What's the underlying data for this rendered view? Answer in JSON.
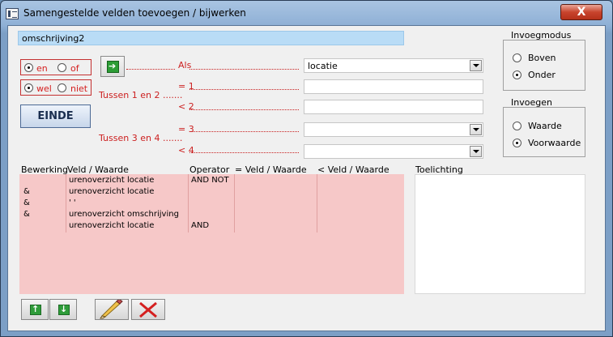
{
  "window": {
    "title": "Samengestelde velden toevoegen / bijwerken",
    "close_label": "X"
  },
  "description_field": {
    "value": "omschrijving2"
  },
  "logic1": {
    "options": [
      "en",
      "of"
    ],
    "selected": "en"
  },
  "logic2": {
    "options": [
      "wel",
      "niet"
    ],
    "selected": "wel"
  },
  "einde_label": "EINDE",
  "criteria": {
    "als_label": "Als",
    "eq1_label": "= 1",
    "lt2_label": "< 2",
    "eq3_label": "= 3",
    "lt4_label": "< 4",
    "between12_label": "Tussen 1 en 2 .......",
    "between34_label": "Tussen 3 en 4 .......",
    "als_value": "locatie",
    "eq1_value": "",
    "lt2_value": "",
    "eq3_value": "",
    "lt4_value": ""
  },
  "invoegmodus": {
    "title": "Invoegmodus",
    "options": [
      "Boven",
      "Onder"
    ],
    "selected": "Onder"
  },
  "invoegen": {
    "title": "Invoegen",
    "options": [
      "Waarde",
      "Voorwaarde"
    ],
    "selected": "Voorwaarde"
  },
  "table": {
    "headers": [
      "Bewerking",
      "Veld / Waarde",
      "Operator",
      "= Veld / Waarde",
      "< Veld / Waarde"
    ],
    "rows": [
      [
        "",
        "urenoverzicht locatie",
        "AND NOT",
        "",
        ""
      ],
      [
        "&",
        "urenoverzicht locatie",
        "",
        "",
        ""
      ],
      [
        "&",
        "' '",
        "",
        "",
        ""
      ],
      [
        "&",
        "urenoverzicht omschrijving",
        "",
        "",
        ""
      ],
      [
        "",
        "urenoverzicht locatie",
        "AND",
        "",
        ""
      ]
    ]
  },
  "toelichting": {
    "label": "Toelichting",
    "value": ""
  },
  "toolbar": {
    "up_icon": "arrow-up-icon",
    "down_icon": "arrow-down-icon",
    "edit_icon": "pencil-icon",
    "delete_icon": "delete-x-icon"
  },
  "colors": {
    "list_bg": "#f6c8c8",
    "desc_bg": "#b9dcf6",
    "label_red": "#cc2020",
    "close_red": "#c8442d"
  }
}
